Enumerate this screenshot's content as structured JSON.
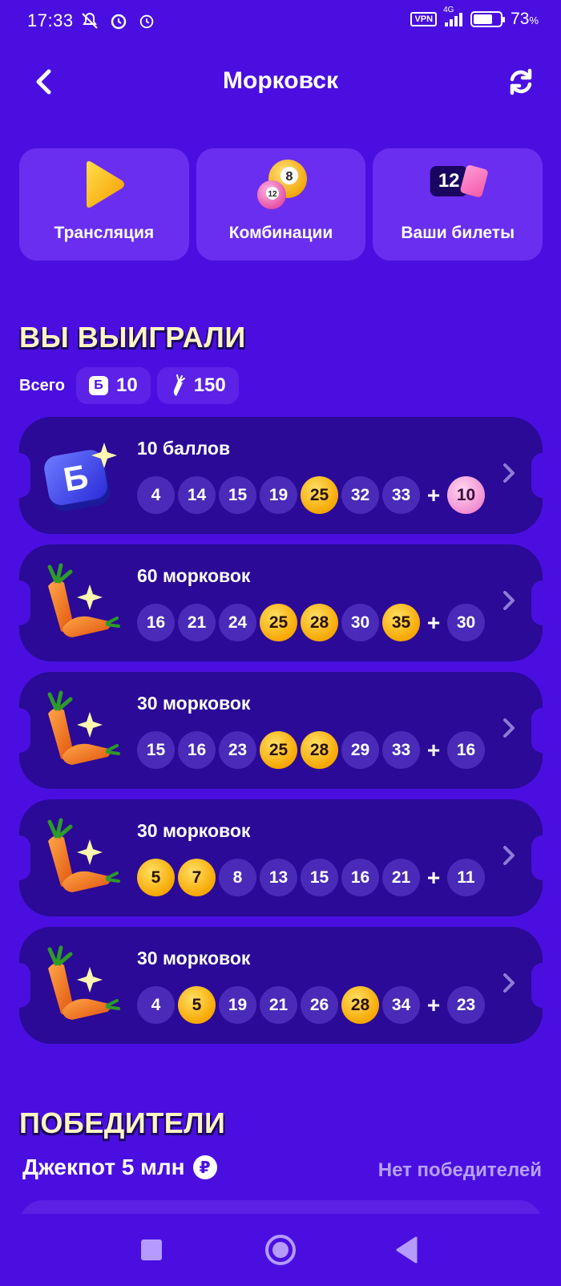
{
  "status_bar": {
    "time": "17:33",
    "left_icons": [
      "mute-icon",
      "alarm-icon",
      "alarm-icon"
    ],
    "vpn": "VPN",
    "network": "4G",
    "battery_percent_value": "73",
    "battery_percent_sign": "%",
    "battery_level": 0.73
  },
  "header": {
    "title": "Морковск",
    "back_icon": "chevron-left-icon",
    "refresh_icon": "refresh-icon"
  },
  "tiles": [
    {
      "label": "Трансляция",
      "icon": "play-icon"
    },
    {
      "label": "Комбинации",
      "icon": "lottery-balls-icon",
      "ball_numbers": [
        "8",
        "12"
      ]
    },
    {
      "label": "Ваши билеты",
      "icon": "ticket-icon",
      "count": "12"
    }
  ],
  "won_section": {
    "heading": "ВЫ ВЫИГРАЛИ",
    "total_label": "Всего",
    "points_badge": "Б",
    "points_total": "10",
    "carrots_total": "150"
  },
  "win_cards": [
    {
      "prize": "10 баллов",
      "icon": "points-b-icon",
      "icon_letter": "Б",
      "balls": [
        {
          "n": "4",
          "hit": false
        },
        {
          "n": "14",
          "hit": false
        },
        {
          "n": "15",
          "hit": false
        },
        {
          "n": "19",
          "hit": false
        },
        {
          "n": "25",
          "hit": true
        },
        {
          "n": "32",
          "hit": false
        },
        {
          "n": "33",
          "hit": false
        }
      ],
      "bonus": {
        "n": "10",
        "hit": true
      }
    },
    {
      "prize": "60 морковок",
      "icon": "carrot-icon",
      "balls": [
        {
          "n": "16",
          "hit": false
        },
        {
          "n": "21",
          "hit": false
        },
        {
          "n": "24",
          "hit": false
        },
        {
          "n": "25",
          "hit": true
        },
        {
          "n": "28",
          "hit": true
        },
        {
          "n": "30",
          "hit": false
        },
        {
          "n": "35",
          "hit": true
        }
      ],
      "bonus": {
        "n": "30",
        "hit": false
      }
    },
    {
      "prize": "30 морковок",
      "icon": "carrot-icon",
      "balls": [
        {
          "n": "15",
          "hit": false
        },
        {
          "n": "16",
          "hit": false
        },
        {
          "n": "23",
          "hit": false
        },
        {
          "n": "25",
          "hit": true
        },
        {
          "n": "28",
          "hit": true
        },
        {
          "n": "29",
          "hit": false
        },
        {
          "n": "33",
          "hit": false
        }
      ],
      "bonus": {
        "n": "16",
        "hit": false
      }
    },
    {
      "prize": "30 морковок",
      "icon": "carrot-icon",
      "balls": [
        {
          "n": "5",
          "hit": true
        },
        {
          "n": "7",
          "hit": true
        },
        {
          "n": "8",
          "hit": false
        },
        {
          "n": "13",
          "hit": false
        },
        {
          "n": "15",
          "hit": false
        },
        {
          "n": "16",
          "hit": false
        },
        {
          "n": "21",
          "hit": false
        }
      ],
      "bonus": {
        "n": "11",
        "hit": false
      }
    },
    {
      "prize": "30 морковок",
      "icon": "carrot-icon",
      "balls": [
        {
          "n": "4",
          "hit": false
        },
        {
          "n": "5",
          "hit": true
        },
        {
          "n": "19",
          "hit": false
        },
        {
          "n": "21",
          "hit": false
        },
        {
          "n": "26",
          "hit": false
        },
        {
          "n": "28",
          "hit": true
        },
        {
          "n": "34",
          "hit": false
        }
      ],
      "bonus": {
        "n": "23",
        "hit": false
      }
    }
  ],
  "winners_section": {
    "heading": "ПОБЕДИТЕЛИ",
    "jackpot_label": "Джекпот 5 млн",
    "currency_symbol": "₽",
    "no_winners": "Нет победителей"
  },
  "nav": [
    "recent-apps-icon",
    "home-icon",
    "back-icon"
  ],
  "colors": {
    "background": "#4a0fe0",
    "card": "#2a0a96",
    "tile": "#6a2ef0",
    "hit_ball": "#f7a700",
    "bonus_ball": "#f08ad0",
    "heading": "#fff4c2"
  }
}
